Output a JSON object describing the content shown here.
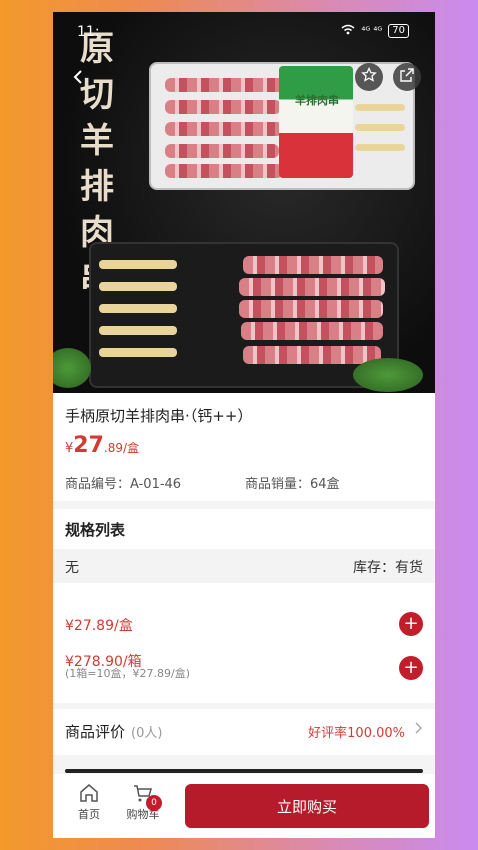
{
  "status_bar": {
    "time": "11:",
    "network": "⁴ᴳ ⁴ᴳ",
    "battery": "70"
  },
  "hero": {
    "artwork_title": "原切羊排肉串",
    "package_label": "羊排肉串"
  },
  "product": {
    "title": "手柄原切羊排肉串·（钙++）",
    "price_symbol": "¥",
    "price_int": "27",
    "price_dec": ".89",
    "price_unit": "/盒",
    "code_label": "商品编号：A-01-46",
    "sales_label": "商品销量：64盒"
  },
  "specs": {
    "title": "规格列表",
    "option": "无",
    "stock": "库存：有货",
    "rows": [
      {
        "price": "¥27.89/盒"
      },
      {
        "price": "¥278.90/箱",
        "note": "(1箱=10盒，¥27.89/盒)"
      }
    ]
  },
  "review": {
    "title": "商品评价",
    "count": "(0人)",
    "rate": "好评率100.00%"
  },
  "bottom": {
    "home_label": "首页",
    "cart_label": "购物车",
    "cart_count": "0",
    "buy_label": "立即购买"
  },
  "colors": {
    "accent": "#c21d2a",
    "price": "#d23b32"
  }
}
